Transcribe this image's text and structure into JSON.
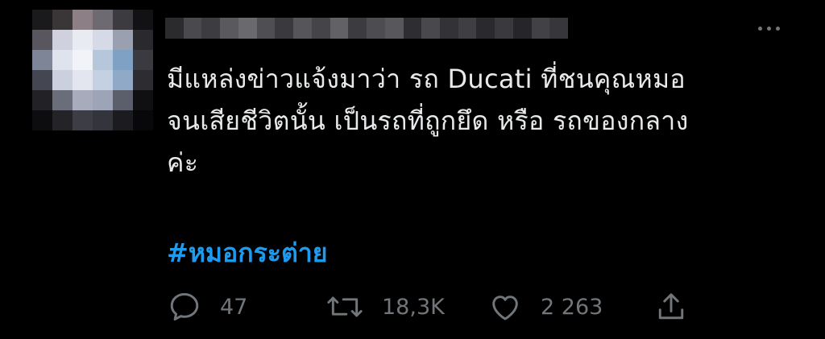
{
  "tweet": {
    "text": "มีแหล่งข่าวแจ้งมาว่า รถ Ducati ที่ชนคุณหมอ\nจนเสียชีวิตนั้น เป็นรถที่ถูกยึด หรือ รถของกลาง\nค่ะ",
    "hashtag": "#หมอกระต่าย",
    "hashtag_color": "#1d9bf0",
    "text_color": "#e7e9ea",
    "muted_color": "#71767b",
    "background": "#000000"
  },
  "author": {
    "avatar": "pixelated-avatar",
    "username": "pixelated-username"
  },
  "actions": {
    "reply": {
      "icon": "reply-icon",
      "count": "47"
    },
    "retweet": {
      "icon": "retweet-icon",
      "count": "18,3K"
    },
    "like": {
      "icon": "heart-icon",
      "count": "2 263"
    },
    "share": {
      "icon": "share-icon"
    }
  },
  "more": {
    "icon": "more-options-icon"
  }
}
